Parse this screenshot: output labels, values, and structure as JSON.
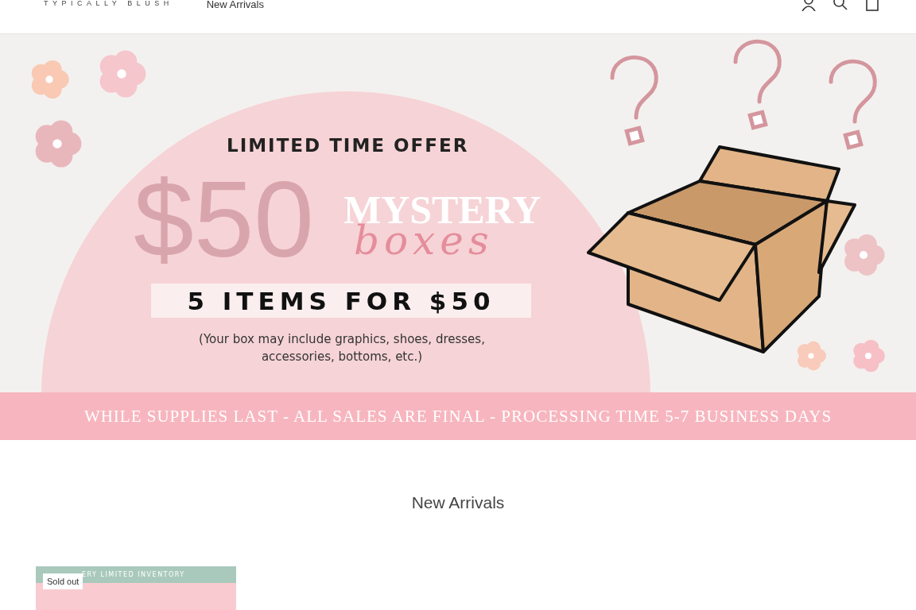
{
  "header": {
    "logo": "TYPICALLY BLUSH",
    "nav": [
      {
        "label": "New Arrivals"
      }
    ]
  },
  "hero_banner": {
    "headline": "LIMITED TIME OFFER",
    "price": "$50",
    "title": "MYSTERY",
    "script_title": "boxes",
    "offer": "5 ITEMS FOR $50",
    "note": "(Your box may include graphics, shoes, dresses, accessories, bottoms, etc.)",
    "ribbon": "WHILE SUPPLIES LAST - ALL SALES ARE FINAL - PROCESSING TIME 5-7 BUSINESS DAYS"
  },
  "section_title": "New Arrivals",
  "products": [
    {
      "badge": "Sold out",
      "image_caption": "ERY LIMITED INVENTORY"
    }
  ]
}
